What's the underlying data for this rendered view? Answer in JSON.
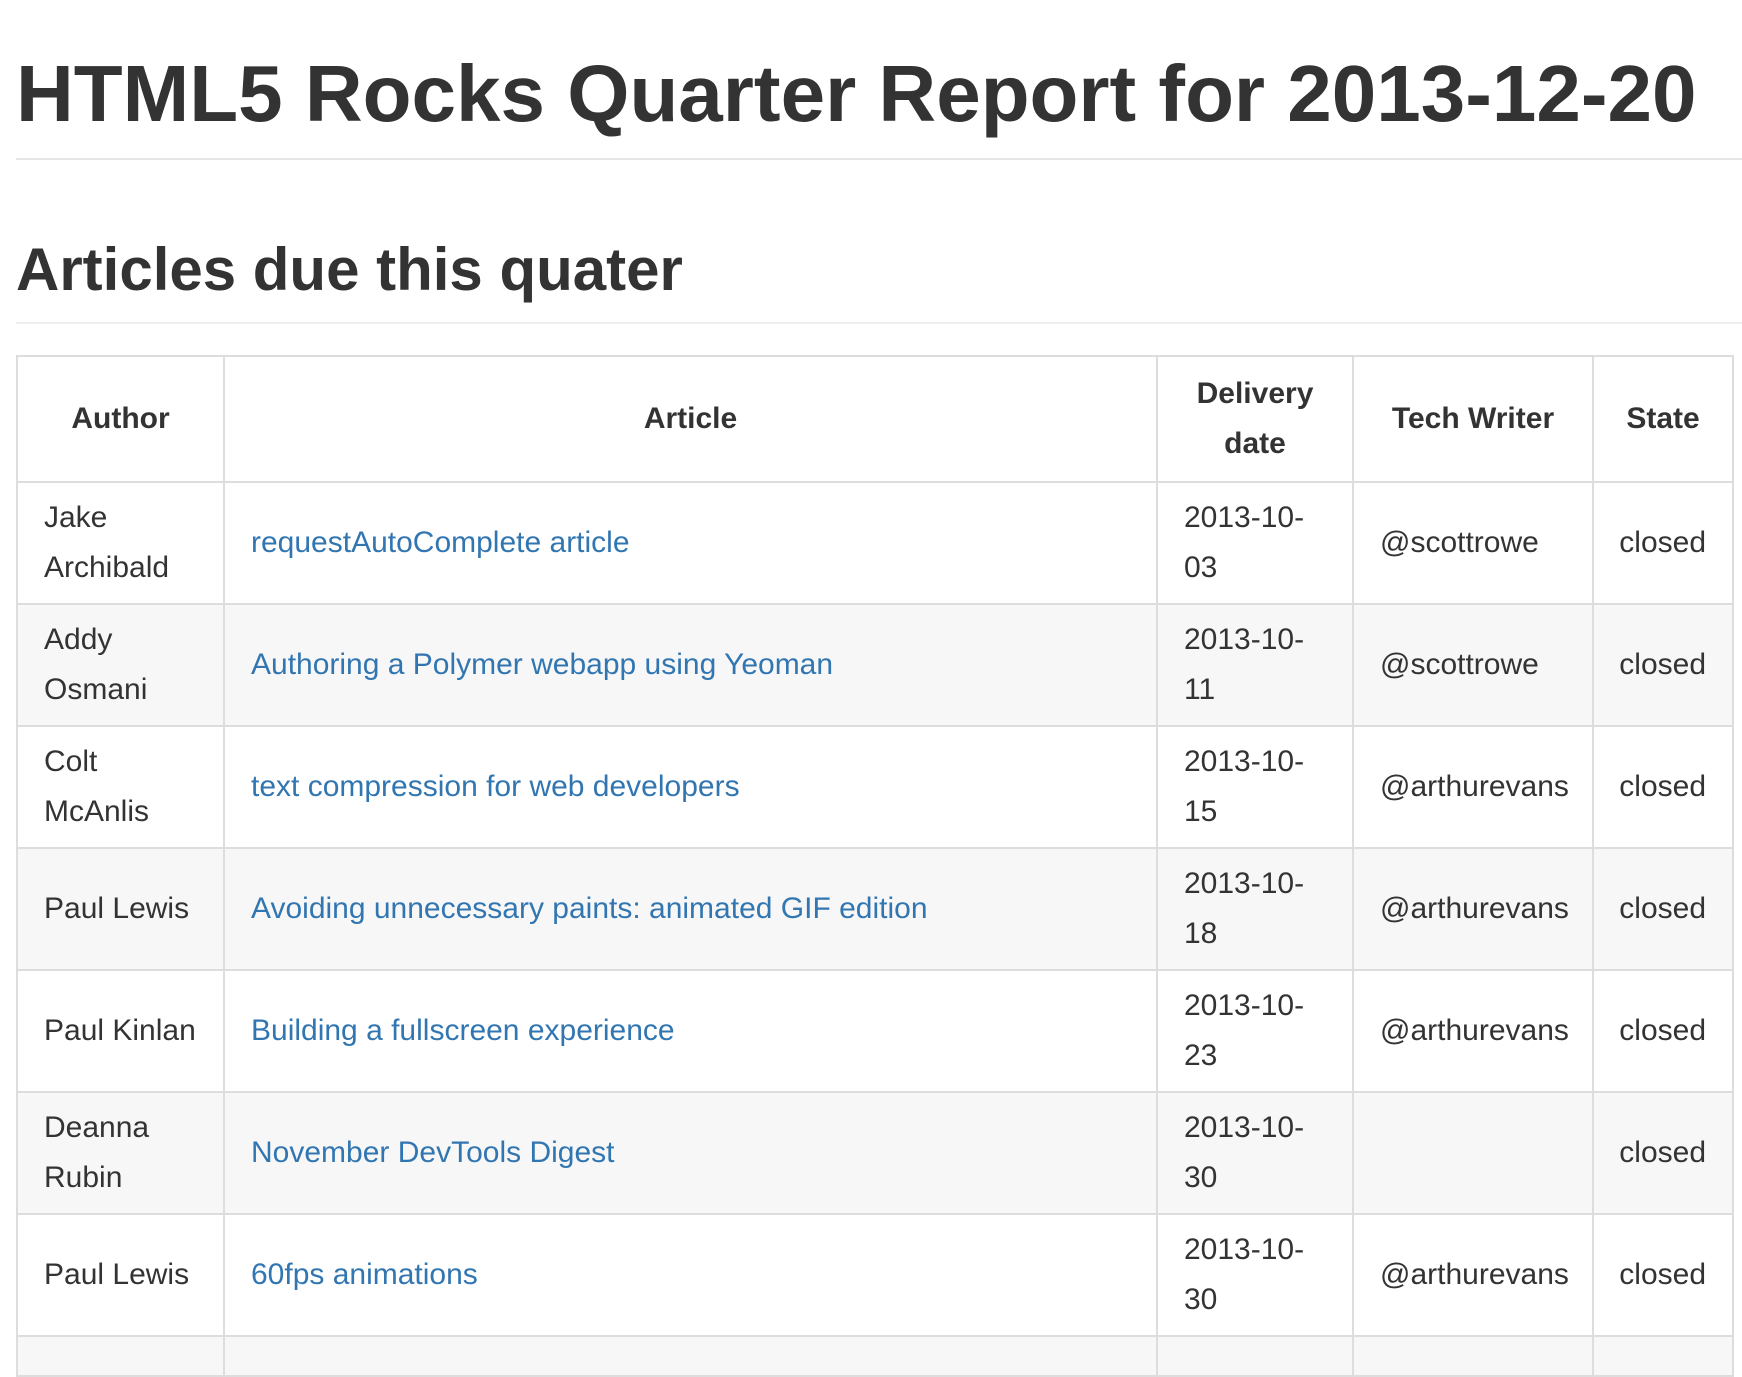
{
  "page": {
    "title": "HTML5 Rocks Quarter Report for 2013-12-20",
    "section_title": "Articles due this quater"
  },
  "table": {
    "headers": {
      "author": "Author",
      "article": "Article",
      "delivery_date_line1": "Delivery",
      "delivery_date_line2": "date",
      "tech_writer": "Tech Writer",
      "state": "State"
    },
    "rows": [
      {
        "author_line1": "Jake",
        "author_line2": "Archibald",
        "article": "requestAutoComplete article",
        "date_line1": "2013-10-",
        "date_line2": "03",
        "tech_writer": "@scottrowe",
        "state": "closed"
      },
      {
        "author_line1": "Addy",
        "author_line2": "Osmani",
        "article": "Authoring a Polymer webapp using Yeoman",
        "date_line1": "2013-10-",
        "date_line2": "11",
        "tech_writer": "@scottrowe",
        "state": "closed"
      },
      {
        "author_line1": "Colt",
        "author_line2": "McAnlis",
        "article": "text compression for web developers",
        "date_line1": "2013-10-",
        "date_line2": "15",
        "tech_writer": "@arthurevans",
        "state": "closed"
      },
      {
        "author_line1": "Paul Lewis",
        "author_line2": "",
        "article": "Avoiding unnecessary paints: animated GIF edition",
        "date_line1": "2013-10-",
        "date_line2": "18",
        "tech_writer": "@arthurevans",
        "state": "closed"
      },
      {
        "author_line1": "Paul Kinlan",
        "author_line2": "",
        "article": "Building a fullscreen experience",
        "date_line1": "2013-10-",
        "date_line2": "23",
        "tech_writer": "@arthurevans",
        "state": "closed"
      },
      {
        "author_line1": "Deanna",
        "author_line2": "Rubin",
        "article": "November DevTools Digest",
        "date_line1": "2013-10-",
        "date_line2": "30",
        "tech_writer": "",
        "state": "closed"
      },
      {
        "author_line1": "Paul Lewis",
        "author_line2": "",
        "article": "60fps animations",
        "date_line1": "2013-10-",
        "date_line2": "30",
        "tech_writer": "@arthurevans",
        "state": "closed"
      }
    ]
  }
}
